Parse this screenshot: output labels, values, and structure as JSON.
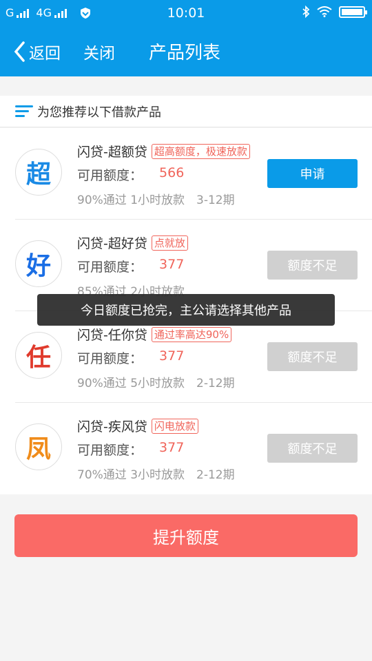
{
  "status": {
    "carrier1": "G",
    "carrier2": "4G",
    "time": "10:01"
  },
  "nav": {
    "back_label": "返回",
    "close_label": "关闭",
    "title": "产品列表"
  },
  "section": {
    "title": "为您推荐以下借款产品"
  },
  "products": [
    {
      "logo": "超",
      "logo_color": "#1a8ae5",
      "name": "闪贷-超额贷",
      "tag": "超高额度，极速放款",
      "quota_label": "可用额度：",
      "quota": "566",
      "meta": "90%通过 1小时放款　3-12期",
      "action": "申请",
      "enabled": true
    },
    {
      "logo": "好",
      "logo_color": "#1a6ee5",
      "name": "闪贷-超好贷",
      "tag": "点就放",
      "quota_label": "可用额度：",
      "quota": "377",
      "meta": "85%通过 2小时放款",
      "action": "额度不足",
      "enabled": false
    },
    {
      "logo": "任",
      "logo_color": "#e03a2c",
      "name": "闪贷-任你贷",
      "tag": "通过率高达90%",
      "quota_label": "可用额度：",
      "quota": "377",
      "meta": "90%通过 5小时放款　2-12期",
      "action": "额度不足",
      "enabled": false
    },
    {
      "logo": "凤",
      "logo_color": "#f08c1a",
      "name": "闪贷-疾风贷",
      "tag": "闪电放款",
      "quota_label": "可用额度：",
      "quota": "377",
      "meta": "70%通过 3小时放款　2-12期",
      "action": "额度不足",
      "enabled": false
    }
  ],
  "footer": {
    "raise_label": "提升额度"
  },
  "toast": {
    "message": "今日额度已抢完，主公请选择其他产品"
  },
  "colors": {
    "primary": "#0a9be8",
    "accent": "#fa6a66",
    "tag": "#f0645a"
  }
}
